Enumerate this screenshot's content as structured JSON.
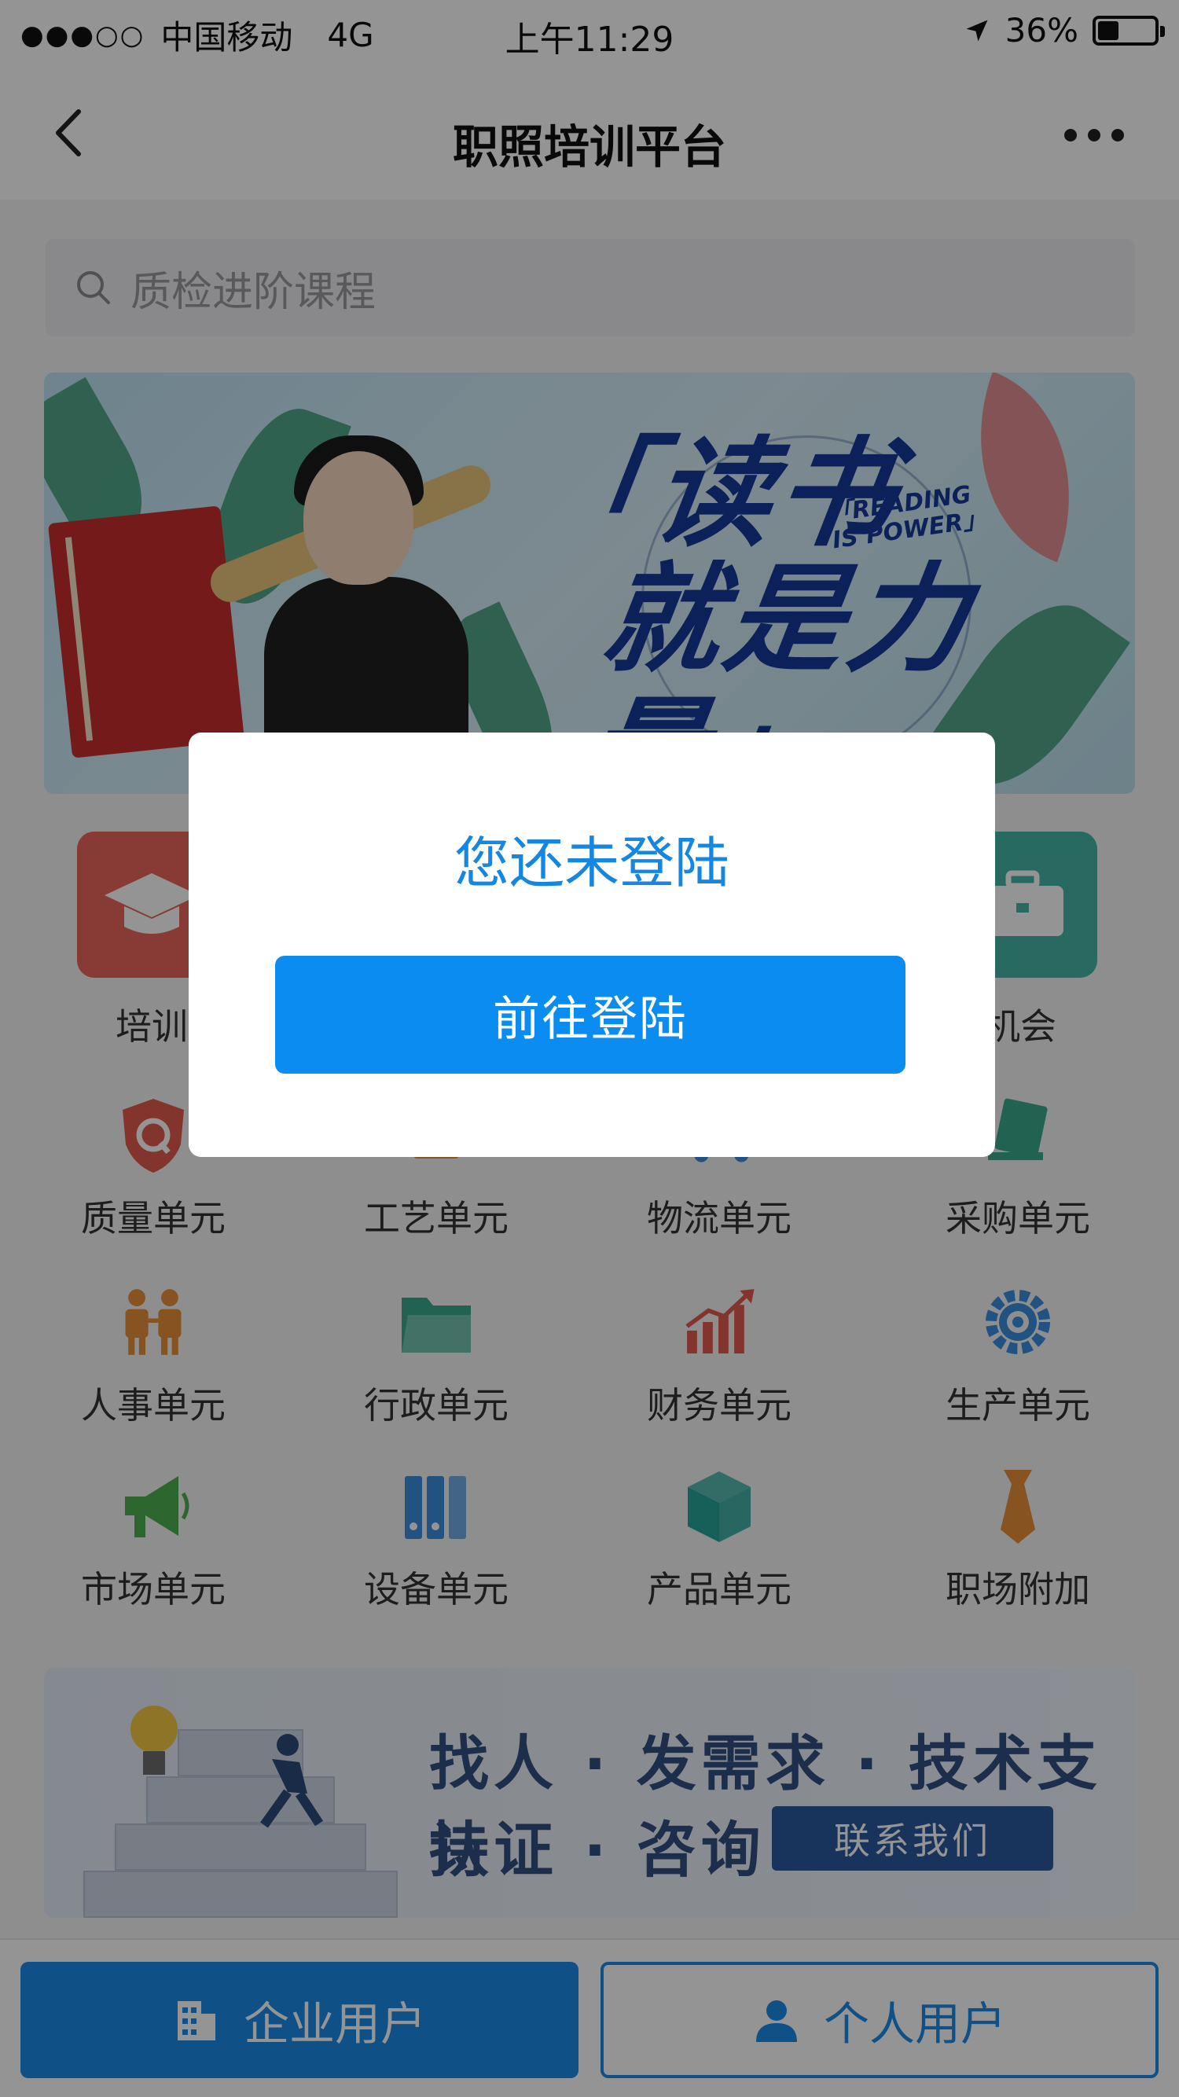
{
  "status_bar": {
    "signal": "●●●○○",
    "carrier": "中国移动",
    "network": "4G",
    "time": "上午11:29",
    "battery_percent": "36%",
    "battery_level": 0.36
  },
  "nav": {
    "title": "职照培训平台"
  },
  "search": {
    "placeholder": "质检进阶课程"
  },
  "banner": {
    "line1": "「读书",
    "line2": "就是力量」",
    "english_1": "「READING",
    "english_2": "IS POWER」"
  },
  "top_tiles": [
    {
      "label": "培训",
      "icon": "graduation-cap-icon",
      "color": "#e8665a"
    },
    {
      "label": "作机会",
      "icon": "briefcase-icon",
      "color": "#45b7a8"
    }
  ],
  "menu": [
    {
      "label": "质量单元",
      "icon": "quality-shield-icon",
      "color": "#e05a4f"
    },
    {
      "label": "工艺单元",
      "icon": "craft-icon",
      "color": "#e8903a"
    },
    {
      "label": "物流单元",
      "icon": "logistics-icon",
      "color": "#3a8de0"
    },
    {
      "label": "采购单元",
      "icon": "purchase-icon",
      "color": "#3aa98c"
    },
    {
      "label": "人事单元",
      "icon": "people-icon",
      "color": "#e8903a"
    },
    {
      "label": "行政单元",
      "icon": "folder-icon",
      "color": "#3aa98c"
    },
    {
      "label": "财务单元",
      "icon": "finance-chart-icon",
      "color": "#e05a4f"
    },
    {
      "label": "生产单元",
      "icon": "gear-icon",
      "color": "#3a8de0"
    },
    {
      "label": "市场单元",
      "icon": "megaphone-icon",
      "color": "#4caf50"
    },
    {
      "label": "设备单元",
      "icon": "binders-icon",
      "color": "#3a8de0"
    },
    {
      "label": "产品单元",
      "icon": "cube-icon",
      "color": "#26a69a"
    },
    {
      "label": "职场附加",
      "icon": "tie-icon",
      "color": "#e8903a"
    }
  ],
  "banner2": {
    "line1": "找人 · 发需求 · 技术支持",
    "line2": "认证 · 咨询",
    "contact_label": "联系我们"
  },
  "bottom": {
    "enterprise_label": "企业用户",
    "personal_label": "个人用户"
  },
  "modal": {
    "title": "您还未登陆",
    "button_label": "前往登陆"
  },
  "colors": {
    "primary": "#1a8ce8",
    "modal_title": "#1687e0"
  }
}
